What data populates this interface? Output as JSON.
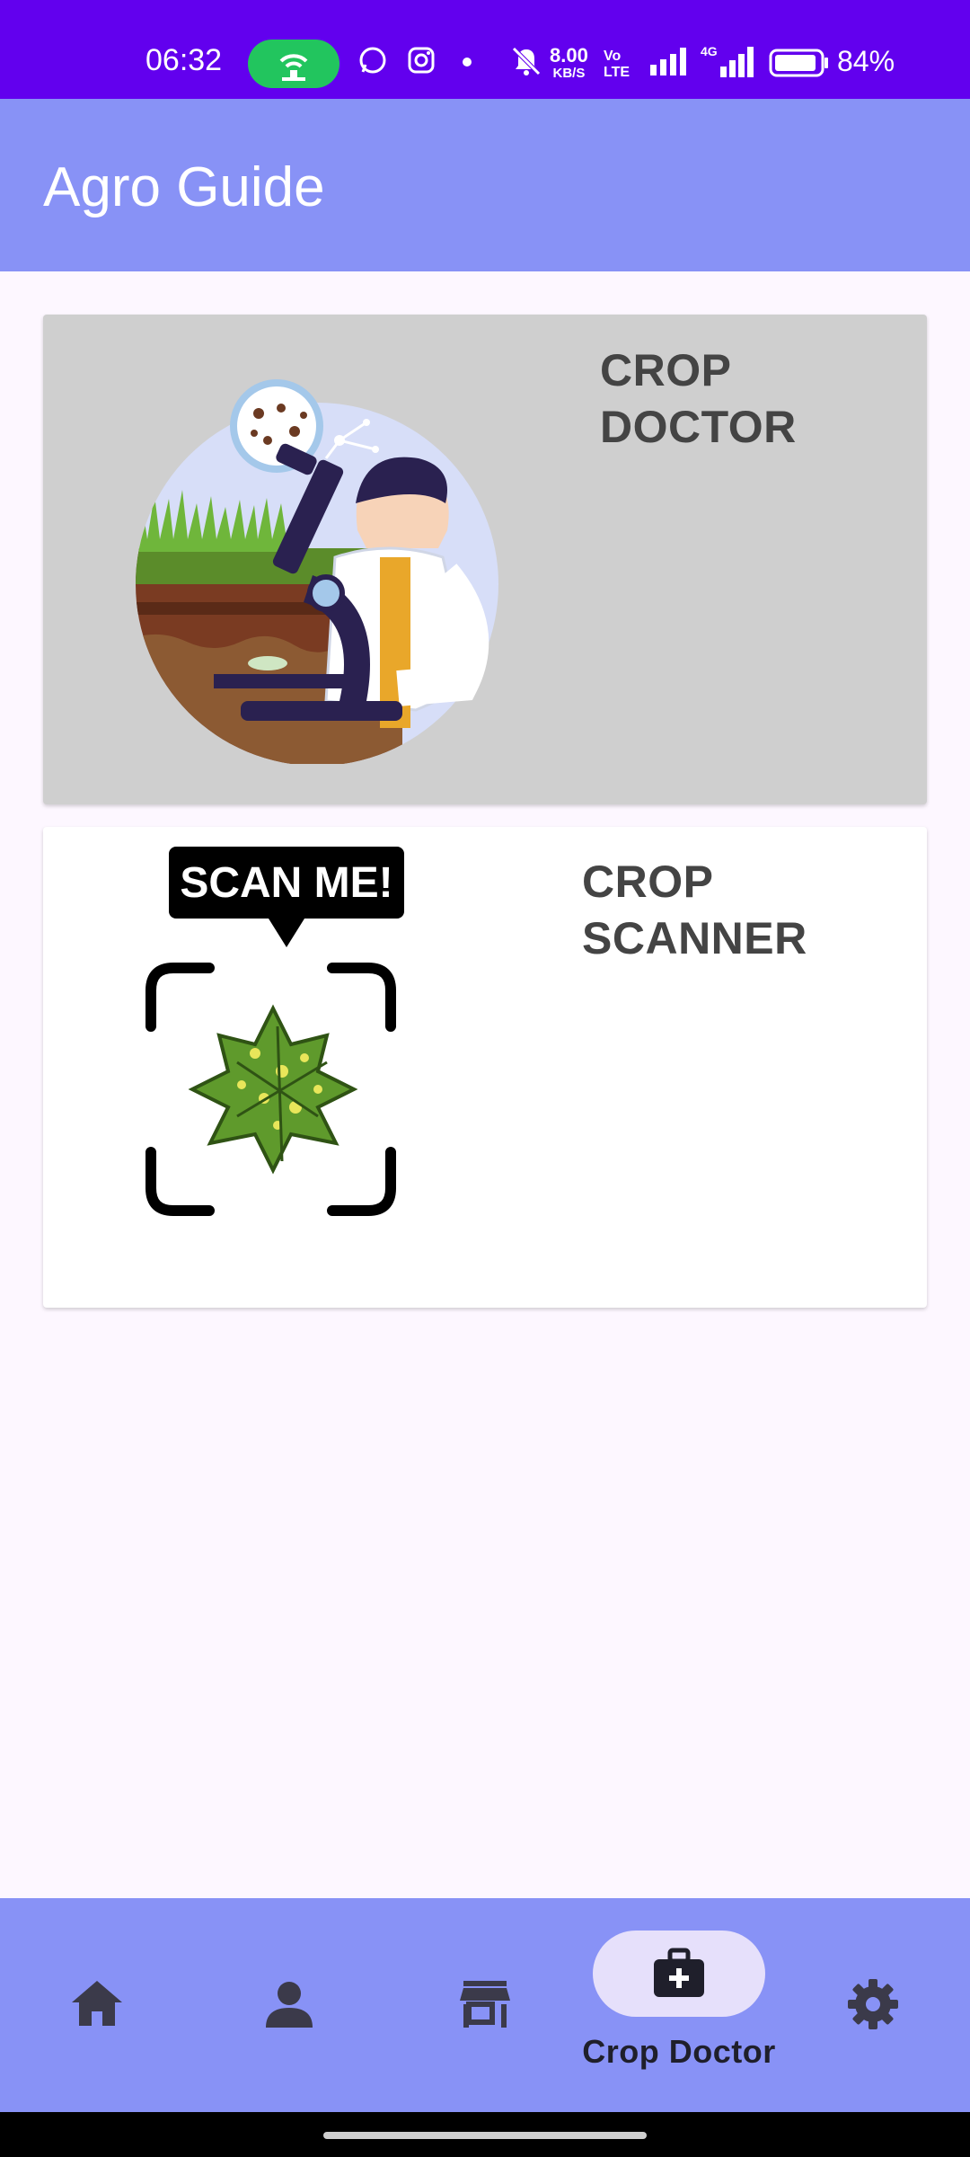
{
  "status_bar": {
    "time": "06:32",
    "net_speed": "8.00",
    "net_speed_unit": "KB/S",
    "volte": "VoLTE2",
    "battery": "84%",
    "icons": [
      "hotspot-icon",
      "whatsapp-icon",
      "instagram-icon",
      "dot-icon",
      "mute-icon",
      "signal-icon",
      "4g-signal-icon",
      "battery-icon"
    ]
  },
  "app_bar": {
    "title": "Agro Guide"
  },
  "cards": [
    {
      "id": "crop-doctor",
      "label_line1": "CROP",
      "label_line2": "DOCTOR",
      "image": "scientist-microscope-illustration"
    },
    {
      "id": "crop-scanner",
      "label_line1": "CROP",
      "label_line2": "SCANNER",
      "image": "scan-me-leaf-illustration",
      "badge_text": "SCAN ME!"
    }
  ],
  "bottom_nav": {
    "items": [
      {
        "icon": "home-icon",
        "label": ""
      },
      {
        "icon": "person-icon",
        "label": ""
      },
      {
        "icon": "store-icon",
        "label": ""
      },
      {
        "icon": "medical-bag-icon",
        "label": "Crop Doctor",
        "selected": true
      },
      {
        "icon": "settings-icon",
        "label": ""
      }
    ]
  },
  "colors": {
    "status_bar": "#6200ee",
    "app_bar": "#8892f6",
    "background": "#fdf7ff",
    "nav_pill": "#e6e0fb",
    "icon": "#3b3a4a"
  }
}
